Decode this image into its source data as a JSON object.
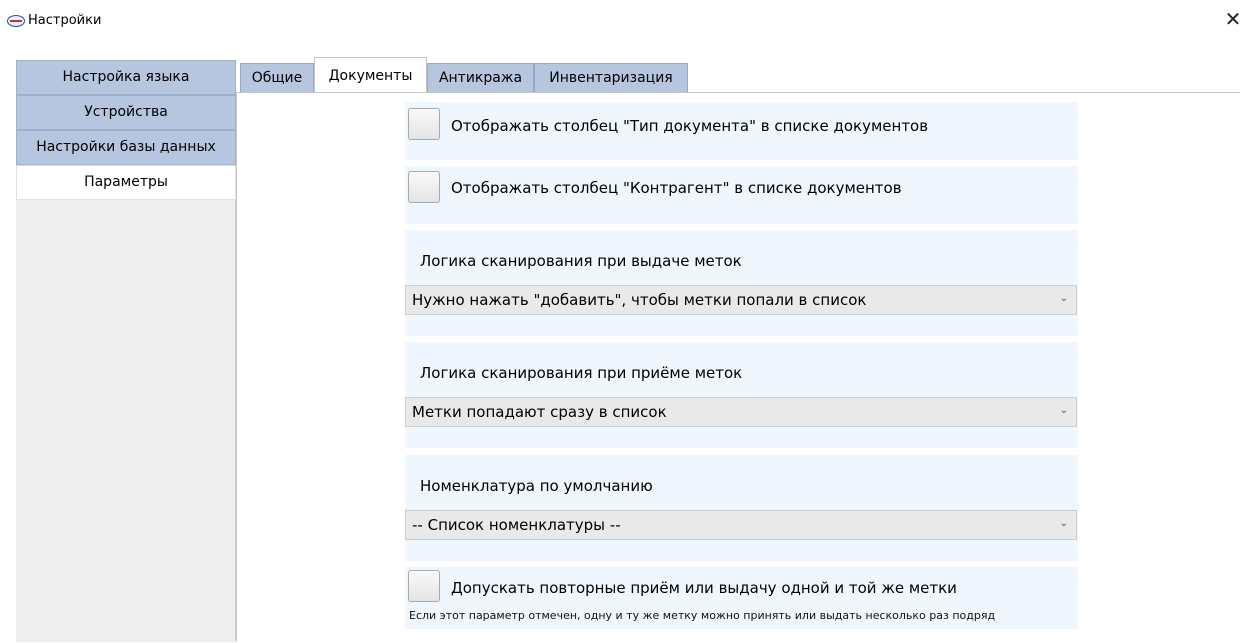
{
  "window": {
    "title": "Настройки",
    "icon": "app-logo-icon",
    "close_glyph": "✕"
  },
  "sidebar": {
    "items": [
      {
        "label": "Настройка языка",
        "active": false
      },
      {
        "label": "Устройства",
        "active": false
      },
      {
        "label": "Настройки базы данных",
        "active": false
      },
      {
        "label": "Параметры",
        "active": true
      }
    ]
  },
  "tabs": [
    {
      "label": "Общие",
      "active": false
    },
    {
      "label": "Документы",
      "active": true
    },
    {
      "label": "Антикража",
      "active": false
    },
    {
      "label": "Инвентаризация",
      "active": false
    }
  ],
  "settings": {
    "show_doc_type": {
      "label": "Отображать столбец \"Тип документа\" в списке документов",
      "checked": false
    },
    "show_counterparty": {
      "label": "Отображать столбец \"Контрагент\" в списке документов",
      "checked": false
    },
    "issue_logic": {
      "label": "Логика сканирования при выдаче меток",
      "value": "Нужно нажать \"добавить\", чтобы метки попали в список"
    },
    "receive_logic": {
      "label": "Логика сканирования при приёме меток",
      "value": "Метки попадают сразу в список"
    },
    "default_nomenclature": {
      "label": "Номенклатура по умолчанию",
      "value": "--  Список номенклатуры  --"
    },
    "allow_repeat": {
      "label": "Допускать повторные приём или выдачу одной и той же метки",
      "note": "Если этот параметр отмечен, одну и ту же метку можно принять или выдать несколько раз подряд",
      "checked": false
    }
  },
  "colors": {
    "sidebar_item_bg": "#b6c6de",
    "block_bg": "#eff6fd",
    "select_bg": "#e9e9e9"
  }
}
